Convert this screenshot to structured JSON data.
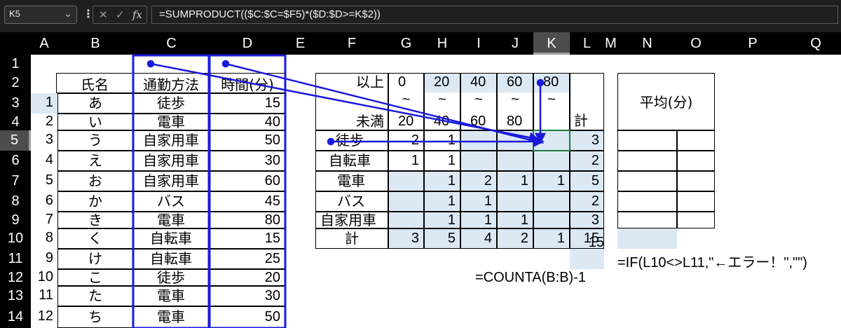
{
  "formula_bar": {
    "name_box": "K5",
    "formula": "=SUMPRODUCT(($C:$C=$F5)*($D:$D>=K$2))",
    "cancel_glyph": "✕",
    "enter_glyph": "✓",
    "fx_glyph": "fx"
  },
  "column_headers": [
    "A",
    "B",
    "C",
    "D",
    "E",
    "F",
    "G",
    "H",
    "I",
    "J",
    "K",
    "L",
    "M",
    "N",
    "O",
    "P",
    "Q"
  ],
  "row_headers": [
    "1",
    "2",
    "3",
    "4",
    "5",
    "6",
    "7",
    "8",
    "9",
    "10",
    "11",
    "12",
    "13",
    "14"
  ],
  "left_table": {
    "headers": [
      "氏名",
      "通勤方法",
      "時間(分)"
    ],
    "rows": [
      {
        "no": "1",
        "name": "あ",
        "method": "徒歩",
        "time": "15"
      },
      {
        "no": "2",
        "name": "い",
        "method": "電車",
        "time": "40"
      },
      {
        "no": "3",
        "name": "う",
        "method": "自家用車",
        "time": "50"
      },
      {
        "no": "4",
        "name": "え",
        "method": "自家用車",
        "time": "30"
      },
      {
        "no": "5",
        "name": "お",
        "method": "自家用車",
        "time": "60"
      },
      {
        "no": "6",
        "name": "か",
        "method": "バス",
        "time": "45"
      },
      {
        "no": "7",
        "name": "き",
        "method": "電車",
        "time": "80"
      },
      {
        "no": "8",
        "name": "く",
        "method": "自転車",
        "time": "15"
      },
      {
        "no": "9",
        "name": "け",
        "method": "自転車",
        "time": "25"
      },
      {
        "no": "10",
        "name": "こ",
        "method": "徒歩",
        "time": "20"
      },
      {
        "no": "11",
        "name": "た",
        "method": "電車",
        "time": "30"
      },
      {
        "no": "12",
        "name": "ち",
        "method": "電車",
        "time": "50"
      }
    ]
  },
  "freq_table": {
    "label_min": "以上",
    "label_max": "未満",
    "tilde": "~",
    "total_label": "計",
    "lower": [
      "0",
      "20",
      "40",
      "60",
      "80"
    ],
    "upper": [
      "20",
      "40",
      "60",
      "80"
    ],
    "rows": [
      {
        "label": "徒歩",
        "vals": [
          "2",
          "1",
          "",
          "",
          ""
        ],
        "total": "3"
      },
      {
        "label": "自転車",
        "vals": [
          "1",
          "1",
          "",
          "",
          ""
        ],
        "total": "2"
      },
      {
        "label": "電車",
        "vals": [
          "",
          "1",
          "2",
          "1",
          "1"
        ],
        "total": "5"
      },
      {
        "label": "バス",
        "vals": [
          "",
          "1",
          "1",
          "",
          ""
        ],
        "total": "2"
      },
      {
        "label": "自家用車",
        "vals": [
          "",
          "1",
          "1",
          "1",
          ""
        ],
        "total": "3"
      }
    ],
    "col_totals": [
      "3",
      "5",
      "4",
      "2",
      "1"
    ],
    "grand_total": "15",
    "count_value": "15",
    "count_formula": "=COUNTA(B:B)-1"
  },
  "avg_table": {
    "header": "平均(分)",
    "error_formula": "=IF(L10<>L11,\"←エラー！\",\"\")"
  },
  "colors": {
    "highlight": "#dce9f5",
    "arrow": "#1a1adc",
    "header_bg": "#000000",
    "selected_header": "#4d4d4d"
  }
}
